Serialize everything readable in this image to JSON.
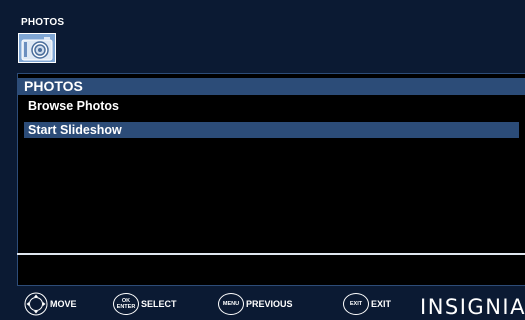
{
  "header": {
    "section_label": "PHOTOS",
    "icon": "camera-icon"
  },
  "menu": {
    "title": "PHOTOS",
    "items": [
      {
        "label": "Browse Photos",
        "selected": false
      },
      {
        "label": "Start Slideshow",
        "selected": true
      }
    ]
  },
  "footer": {
    "hints": [
      {
        "icon": "dpad-icon",
        "label": "MOVE"
      },
      {
        "icon": "ok-enter-button-icon",
        "button_text": "OK ENTER",
        "label": "SELECT"
      },
      {
        "icon": "menu-button-icon",
        "button_text": "MENU",
        "label": "PREVIOUS"
      },
      {
        "icon": "exit-button-icon",
        "button_text": "EXIT",
        "label": "EXIT"
      }
    ],
    "brand": "INSIGNIA"
  },
  "colors": {
    "background": "#0b1a33",
    "highlight": "#2c4c78",
    "text": "#ffffff"
  }
}
